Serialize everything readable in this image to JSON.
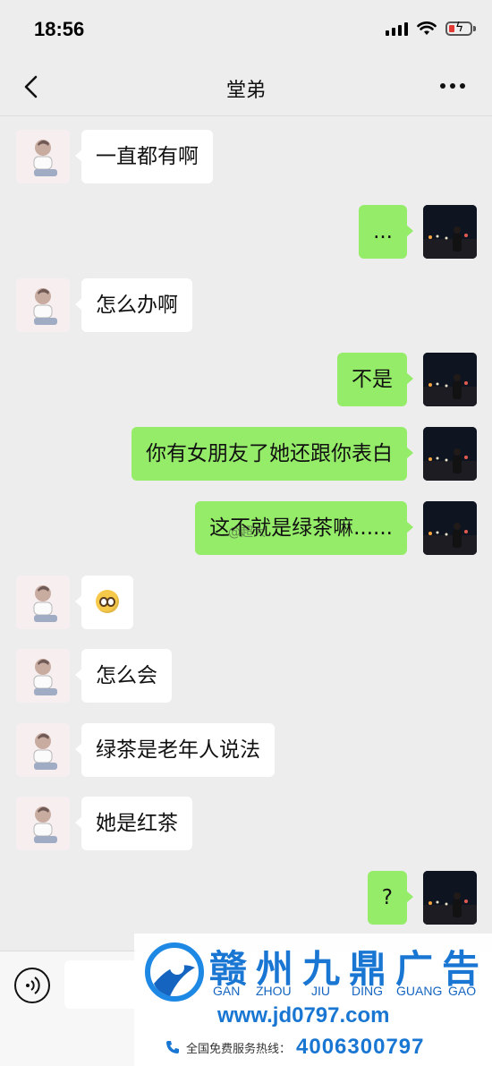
{
  "status_bar": {
    "time": "18:56"
  },
  "nav": {
    "title": "堂弟"
  },
  "messages": [
    {
      "side": "left",
      "text": "一直都有啊"
    },
    {
      "side": "right",
      "text": "..."
    },
    {
      "side": "left",
      "text": "怎么办啊"
    },
    {
      "side": "right",
      "text": "不是"
    },
    {
      "side": "right",
      "text": "你有女朋友了她还跟你表白"
    },
    {
      "side": "right",
      "text": "这不就是绿茶嘛......"
    },
    {
      "side": "left",
      "text": "",
      "emoji": "pleading-face-icon"
    },
    {
      "side": "left",
      "text": "怎么会"
    },
    {
      "side": "left",
      "text": "绿茶是老年人说法"
    },
    {
      "side": "left",
      "text": "她是红茶"
    },
    {
      "side": "right",
      "text": "?"
    }
  ],
  "watermark": "@超大",
  "ad": {
    "title": "赣州九鼎广告",
    "pinyin": [
      "GAN",
      "ZHOU",
      "JIU",
      "DING",
      "GUANG",
      "GAO"
    ],
    "url": "www.jd0797.com",
    "hotline_label": "全国免费服务热线：",
    "phone": "4006300797",
    "colors": {
      "brand": "#1976d2"
    }
  },
  "colors": {
    "background": "#ededed",
    "bubble_self": "#95ec69",
    "bubble_other": "#ffffff"
  }
}
